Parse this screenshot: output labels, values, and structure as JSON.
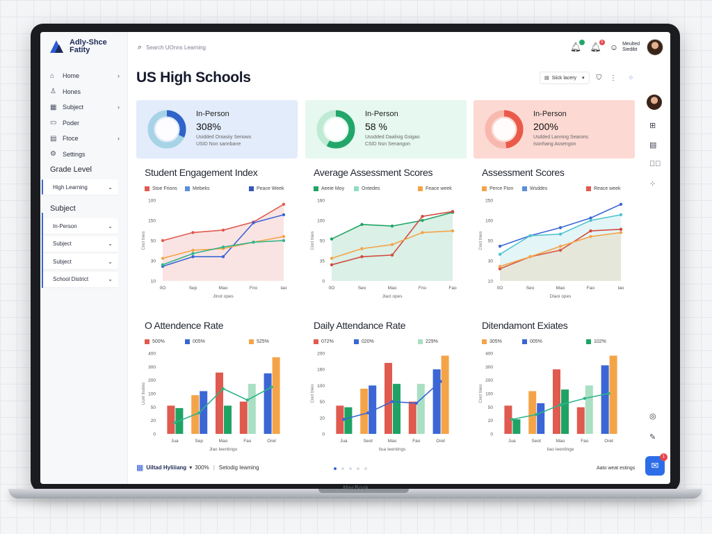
{
  "app": {
    "logo_text": "Adly-Shce Fatity"
  },
  "device": {
    "brand": "MacBook"
  },
  "search": {
    "placeholder": "Search UOnns Learning"
  },
  "notifications": {
    "badge1": "",
    "badge2": "5"
  },
  "profile": {
    "line1": "Meulted",
    "line2": "Siedibt"
  },
  "page": {
    "title": "US High Schools"
  },
  "toolbar": {
    "filter_label": "Siick lacery"
  },
  "sidebar": {
    "items": [
      {
        "label": "Home",
        "icon": "home-icon",
        "chevron": true
      },
      {
        "label": "Hones",
        "icon": "user-icon",
        "chevron": false
      },
      {
        "label": "Subject",
        "icon": "calendar-icon",
        "chevron": true
      },
      {
        "label": "Poder",
        "icon": "folder-icon",
        "chevron": false
      },
      {
        "label": "Ftoce",
        "icon": "document-icon",
        "chevron": true
      },
      {
        "label": "Settings",
        "icon": "settings-icon",
        "chevron": false
      }
    ],
    "grade_title": "Grade Level",
    "grade_value": "High Learning",
    "subject_title": "Subject",
    "filters": [
      "In-Person",
      "Subject",
      "Subject",
      "School District"
    ]
  },
  "stats": [
    {
      "title": "In-Person",
      "value": "308%",
      "sub1": "Usidded Oniasiiy Seriows",
      "sub2": "USID Non sannbane",
      "bg": "#e3ecfb",
      "ring_main": "#2f63c9",
      "ring_light": "#a7d3e6",
      "fraction": 0.32
    },
    {
      "title": "In-Person",
      "value": "58 %",
      "sub1": "Ussdded Daalisig Gsigao",
      "sub2": "CSID Nsn Senangon",
      "bg": "#e6f8ef",
      "ring_main": "#22a66a",
      "ring_light": "#bfead4",
      "fraction": 0.58
    },
    {
      "title": "In-Person",
      "value": "200%",
      "sub1": "Usdded Lanning Searons",
      "sub2": "Isonhang Assengon",
      "bg": "#fcd9d3",
      "ring_main": "#ea5a4a",
      "ring_light": "#f8b8ae",
      "fraction": 0.48
    }
  ],
  "chart_data": [
    {
      "type": "line",
      "title": "Student Engagement Index",
      "legend": [
        {
          "name": "Stoe Frions",
          "color": "#e05a4f"
        },
        {
          "name": "Mebeks",
          "color": "#5b8fd8"
        },
        {
          "name": "Peace Week",
          "color": "#3556b8"
        }
      ],
      "categories": [
        "0O",
        "Sep",
        "Mao",
        "Fno",
        "Iao"
      ],
      "yticks": [
        "100",
        "150",
        "50",
        "30",
        "10"
      ],
      "ylabel": "Cnot tnies",
      "xlabel": "Jlnot opes",
      "ylim": [
        0,
        100
      ],
      "series": [
        {
          "name": "Stoe Frions",
          "color": "#e05a4f",
          "fill": true,
          "values": [
            50,
            60,
            63,
            73,
            95
          ]
        },
        {
          "name": "Mebeks",
          "color": "#3a66d6",
          "fill": false,
          "values": [
            18,
            30,
            30,
            72,
            82
          ]
        },
        {
          "name": "Peace Week",
          "color": "#f4a448",
          "fill": false,
          "values": [
            28,
            38,
            40,
            48,
            55
          ]
        },
        {
          "name": "",
          "color": "#2fb58a",
          "fill": false,
          "values": [
            20,
            34,
            42,
            48,
            50
          ]
        }
      ]
    },
    {
      "type": "line",
      "title": "Average Assessment Scores",
      "legend": [
        {
          "name": "Aeeie Moy",
          "color": "#1fa365"
        },
        {
          "name": "Ontedes",
          "color": "#8fdcc0"
        },
        {
          "name": "Feace week",
          "color": "#f4a448"
        }
      ],
      "categories": [
        "0O",
        "Seo",
        "Mao",
        "Fno",
        "Fao"
      ],
      "yticks": [
        "160",
        "100",
        "50",
        "35",
        "0"
      ],
      "ylabel": "Cnot tnies",
      "xlabel": "Jlacl opes",
      "ylim": [
        0,
        100
      ],
      "series": [
        {
          "name": "Aeeie Moy",
          "color": "#1fa365",
          "fill": true,
          "values": [
            52,
            70,
            68,
            75,
            85
          ]
        },
        {
          "name": "",
          "color": "#d24a3f",
          "fill": false,
          "values": [
            20,
            30,
            32,
            80,
            86
          ]
        },
        {
          "name": "Feace week",
          "color": "#f4a448",
          "fill": false,
          "values": [
            28,
            40,
            45,
            60,
            62
          ]
        }
      ]
    },
    {
      "type": "line",
      "title": "Assessment Scores",
      "legend": [
        {
          "name": "Perce Fton",
          "color": "#f4a448"
        },
        {
          "name": "Wsddes",
          "color": "#5b8fd8"
        },
        {
          "name": "Reace week",
          "color": "#e05a4f"
        }
      ],
      "categories": [
        "0O",
        "Seo",
        "Mao",
        "Fao",
        "Iao"
      ],
      "yticks": [
        "250",
        "100",
        "50",
        "30",
        "10"
      ],
      "ylabel": "Cnot tnies",
      "xlabel": "Dlaoi opes",
      "ylim": [
        0,
        100
      ],
      "series": [
        {
          "name": "Wsddes",
          "color": "#3a66d6",
          "fill": false,
          "values": [
            43,
            56,
            66,
            78,
            95
          ]
        },
        {
          "name": "",
          "color": "#4fc3cf",
          "fill": true,
          "values": [
            33,
            56,
            58,
            75,
            82
          ]
        },
        {
          "name": "Reace week",
          "color": "#d24a3f",
          "fill": false,
          "values": [
            15,
            30,
            38,
            62,
            64
          ]
        },
        {
          "name": "Perce Fton",
          "color": "#f4a448",
          "fill": true,
          "values": [
            18,
            30,
            43,
            55,
            60
          ]
        }
      ]
    },
    {
      "type": "bar",
      "title": "O Attendence Rate",
      "legend": [
        {
          "name": "500%",
          "color": "#e05a4f"
        },
        {
          "name": "005%",
          "color": "#3a66d6"
        },
        {
          "name": "525%",
          "color": "#f4a448"
        }
      ],
      "categories": [
        "Jua",
        "Sep",
        "Mao",
        "Fao",
        "Oret"
      ],
      "yticks": [
        "400",
        "300",
        "200",
        "100",
        "50",
        "20",
        "0"
      ],
      "ylabel": "Llunt tnaties",
      "xlabel": "Jlao Ieentingo",
      "ylim": [
        0,
        100
      ],
      "groups": [
        [
          {
            "color": "#e05a4f",
            "value": 35
          },
          {
            "color": "#1fa365",
            "value": 32
          }
        ],
        [
          {
            "color": "#f4a448",
            "value": 48
          },
          {
            "color": "#3a66d6",
            "value": 53
          }
        ],
        [
          {
            "color": "#e05a4f",
            "value": 76
          },
          {
            "color": "#1fa365",
            "value": 35
          }
        ],
        [
          {
            "color": "#e05a4f",
            "value": 40
          },
          {
            "color": "#a9dfc3",
            "value": 62
          }
        ],
        [
          {
            "color": "#3a66d6",
            "value": 75
          },
          {
            "color": "#f4a448",
            "value": 95
          }
        ]
      ],
      "trend": {
        "color": "#2fb58a",
        "values": [
          14,
          26,
          56,
          42,
          58
        ]
      }
    },
    {
      "type": "bar",
      "title": "Daily Attendance Rate",
      "legend": [
        {
          "name": "072%",
          "color": "#e05a4f"
        },
        {
          "name": "020%",
          "color": "#3a66d6"
        },
        {
          "name": "229%",
          "color": "#a9dfc3"
        }
      ],
      "categories": [
        "Jua",
        "Seot",
        "Mao",
        "Fao",
        "Oret"
      ],
      "yticks": [
        "200",
        "160",
        "100",
        "50",
        "20",
        "0"
      ],
      "ylabel": "Cnot tnies",
      "xlabel": "Iiua Ieentings",
      "ylim": [
        0,
        100
      ],
      "groups": [
        [
          {
            "color": "#e05a4f",
            "value": 35
          },
          {
            "color": "#1fa365",
            "value": 33
          }
        ],
        [
          {
            "color": "#f4a448",
            "value": 56
          },
          {
            "color": "#3a66d6",
            "value": 60
          }
        ],
        [
          {
            "color": "#e05a4f",
            "value": 88
          },
          {
            "color": "#1fa365",
            "value": 62
          }
        ],
        [
          {
            "color": "#e05a4f",
            "value": 40
          },
          {
            "color": "#a9dfc3",
            "value": 62
          }
        ],
        [
          {
            "color": "#3a66d6",
            "value": 80
          },
          {
            "color": "#f4a448",
            "value": 97
          }
        ]
      ],
      "trend": {
        "color": "#3a66d6",
        "values": [
          18,
          26,
          40,
          38,
          65
        ]
      }
    },
    {
      "type": "bar",
      "title": "Ditendamont Exiates",
      "legend": [
        {
          "name": "305%",
          "color": "#f4a448"
        },
        {
          "name": "005%",
          "color": "#3a66d6"
        },
        {
          "name": "102%",
          "color": "#1fa365"
        }
      ],
      "categories": [
        "Jua",
        "Seot",
        "Mao",
        "Fao",
        "Oret"
      ],
      "yticks": [
        "400",
        "300",
        "200",
        "100",
        "50",
        "20",
        "0"
      ],
      "ylabel": "Cnot tnies",
      "xlabel": "Iiao Ieentinge",
      "ylim": [
        0,
        100
      ],
      "groups": [
        [
          {
            "color": "#e05a4f",
            "value": 35
          },
          {
            "color": "#1fa365",
            "value": 18
          }
        ],
        [
          {
            "color": "#f4a448",
            "value": 53
          },
          {
            "color": "#3a66d6",
            "value": 38
          }
        ],
        [
          {
            "color": "#e05a4f",
            "value": 80
          },
          {
            "color": "#1fa365",
            "value": 55
          }
        ],
        [
          {
            "color": "#e05a4f",
            "value": 33
          },
          {
            "color": "#a9dfc3",
            "value": 60
          }
        ],
        [
          {
            "color": "#3a66d6",
            "value": 85
          },
          {
            "color": "#f4a448",
            "value": 97
          }
        ]
      ],
      "trend": {
        "color": "#2fb58a",
        "values": [
          18,
          24,
          36,
          44,
          50
        ]
      }
    }
  ],
  "footer": {
    "left_bold": "Uiltad Hyliiiang",
    "left_mid": "300%",
    "left_tail": "Setodig Ieaming",
    "right": "Aato weat estings",
    "page_count": 5,
    "active_page": 0,
    "fab_badge": "1"
  }
}
